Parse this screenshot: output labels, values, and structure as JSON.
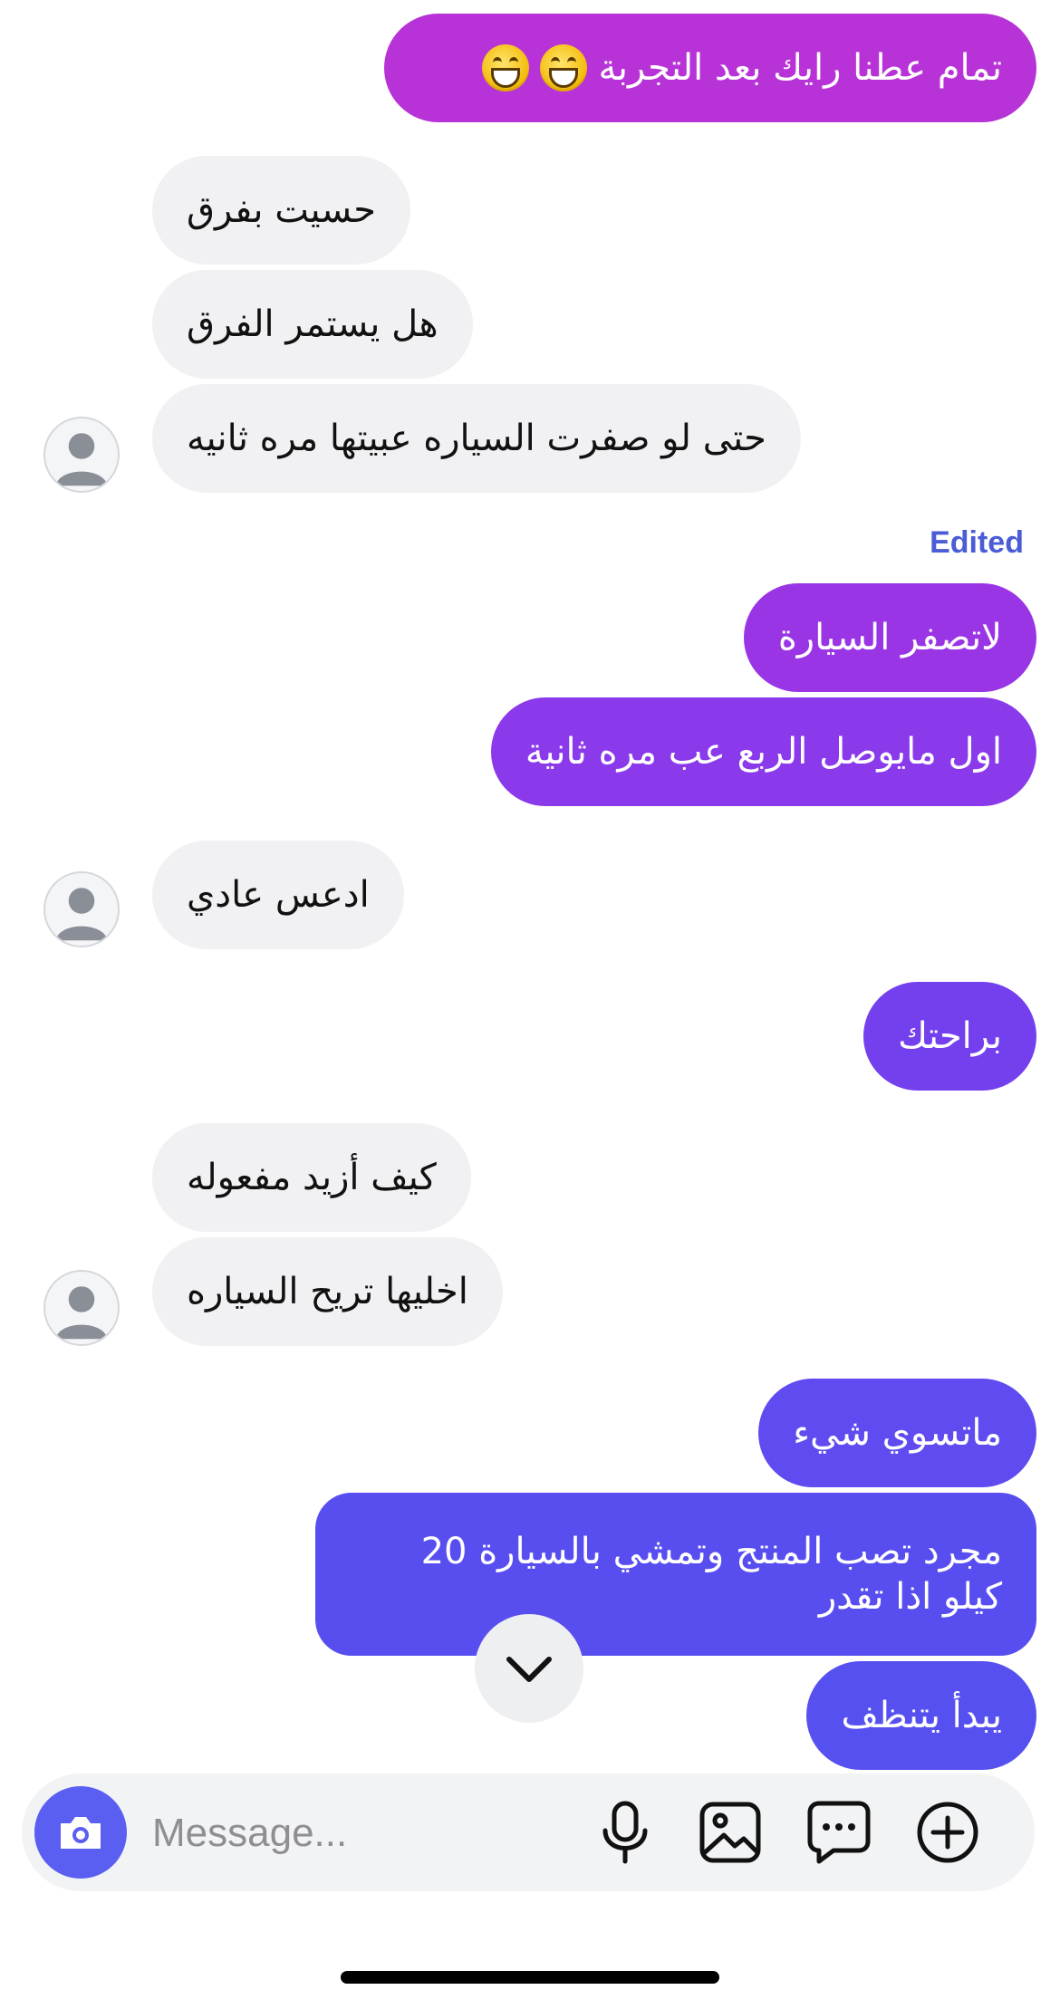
{
  "messages": [
    {
      "id": "m1",
      "direction": "outgoing",
      "text": "تمام عطنا رايك بعد التجربة",
      "emoji": [
        "grinning-face",
        "grinning-face"
      ]
    },
    {
      "id": "m2",
      "direction": "incoming",
      "text": "حسيت بفرق"
    },
    {
      "id": "m3",
      "direction": "incoming",
      "text": "هل يستمر الفرق"
    },
    {
      "id": "m4",
      "direction": "incoming",
      "text": "حتى لو صفرت السياره عبيتها مره ثانيه"
    },
    {
      "id": "m5",
      "direction": "outgoing",
      "text": "لاتصفر السيارة",
      "edited_label": "Edited"
    },
    {
      "id": "m6",
      "direction": "outgoing",
      "text": "اول مايوصل الربع عب مره ثانية"
    },
    {
      "id": "m7",
      "direction": "incoming",
      "text": "ادعس عادي"
    },
    {
      "id": "m8",
      "direction": "outgoing",
      "text": "براحتك"
    },
    {
      "id": "m9",
      "direction": "incoming",
      "text": "كيف أزيد مفعوله"
    },
    {
      "id": "m10",
      "direction": "incoming",
      "text": "اخليها تريح السياره"
    },
    {
      "id": "m11",
      "direction": "outgoing",
      "text": "ماتسوي شيء"
    },
    {
      "id": "m12",
      "direction": "outgoing",
      "lines": [
        "مجرد تصب المنتج وتمشي بالسيارة 20",
        "كيلو اذا تقدر"
      ]
    },
    {
      "id": "m13",
      "direction": "outgoing",
      "text": "يبدأ يتنظف"
    }
  ],
  "composer": {
    "placeholder": "Message...",
    "icons": [
      "camera-icon",
      "microphone-icon",
      "image-icon",
      "sticker-icon",
      "plus-icon"
    ]
  },
  "scroll_button_icon": "chevron-down-icon",
  "colors": {
    "incoming_bubble": "#f1f1f3",
    "outgoing_gradient_top": "#b32fd6",
    "outgoing_gradient_bottom": "#5a4ef0",
    "camera_button": "#5a5ff2",
    "edited_label": "#4a5cd6"
  }
}
